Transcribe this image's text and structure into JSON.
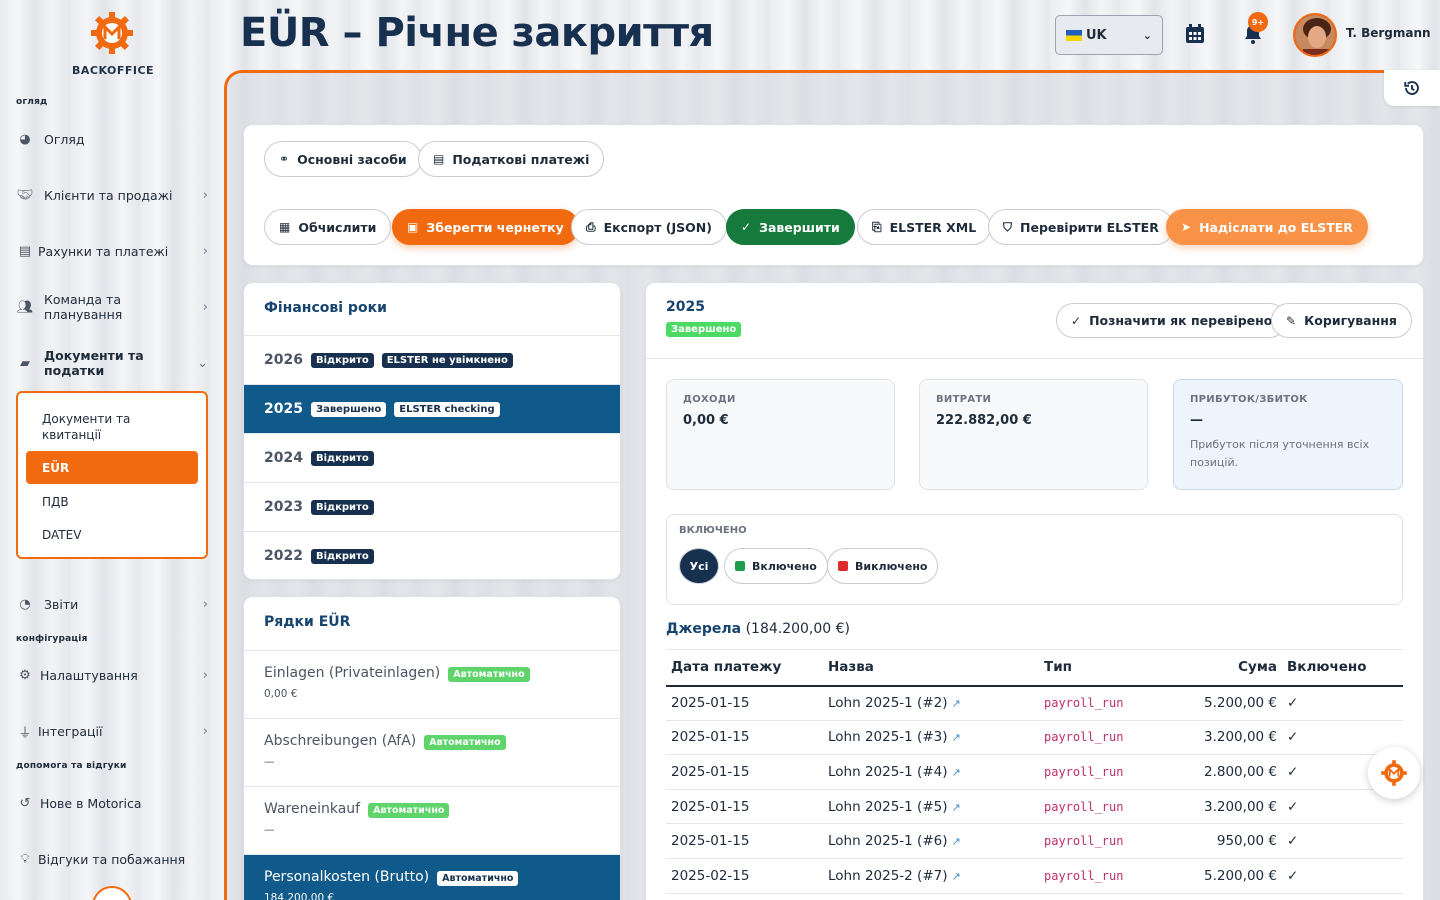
{
  "header": {
    "title": "EÜR – Річне закриття",
    "lang": "UK",
    "user": "T. Bergmann",
    "notif_badge": "9+"
  },
  "logo": {
    "brand": "BACKOFFICE"
  },
  "sidebar": {
    "sections": [
      "огляд",
      "конфігурація",
      "допомога та відгуки"
    ],
    "items": [
      {
        "label": "Огляд",
        "icon": "dashboard-icon"
      },
      {
        "label": "Клієнти та продажі",
        "icon": "handshake-icon"
      },
      {
        "label": "Рахунки та платежі",
        "icon": "invoice-icon"
      },
      {
        "label": "Команда та планування",
        "icon": "users-icon"
      },
      {
        "label": "Документи та податки",
        "icon": "folder-open-icon"
      },
      {
        "label": "Звіти",
        "icon": "pie-chart-icon"
      },
      {
        "label": "Налаштування",
        "icon": "gear-icon"
      },
      {
        "label": "Інтеграції",
        "icon": "plug-icon"
      },
      {
        "label": "Нове в Motorica",
        "icon": "history-icon"
      },
      {
        "label": "Відгуки та побажання",
        "icon": "lightbulb-icon"
      }
    ],
    "sub": [
      "Документи та квитанції",
      "EÜR",
      "ПДВ",
      "DATEV"
    ]
  },
  "toolbar": {
    "row1": [
      "Основні засоби",
      "Податкові платежі"
    ],
    "calc": "Обчислити",
    "save": "Зберегти чернетку",
    "export": "Експорт (JSON)",
    "finish": "Завершити",
    "xml": "ELSTER XML",
    "check": "Перевірити ELSTER",
    "send": "Надіслати до ELSTER"
  },
  "years": {
    "title": "Фінансові роки",
    "rows": [
      {
        "year": "2026",
        "status": "Відкрито",
        "extra": "ELSTER не увімкнено"
      },
      {
        "year": "2025",
        "status": "Завершено",
        "extra": "ELSTER checking"
      },
      {
        "year": "2024",
        "status": "Відкрито",
        "extra": ""
      },
      {
        "year": "2023",
        "status": "Відкрито",
        "extra": ""
      },
      {
        "year": "2022",
        "status": "Відкрито",
        "extra": ""
      }
    ]
  },
  "lines": {
    "title": "Рядки EÜR",
    "auto": "Автоматично",
    "rows": [
      {
        "name": "Einlagen (Privateinlagen)",
        "value": "0,00 €"
      },
      {
        "name": "Abschreibungen (AfA)",
        "value": "—"
      },
      {
        "name": "Wareneinkauf",
        "value": "—"
      },
      {
        "name": "Personalkosten (Brutto)",
        "value": "184.200,00 €"
      }
    ]
  },
  "detail": {
    "year": "2025",
    "status": "Завершено",
    "mark": "Позначити як перевірено",
    "adjust": "Коригування",
    "income_label": "ДОХОДИ",
    "income": "0,00 €",
    "expense_label": "ВИТРАТИ",
    "expense": "222.882,00 €",
    "profit_label": "ПРИБУТОК/ЗБИТОК",
    "profit": "—",
    "profit_hint": "Прибуток після уточнення всіх позицій.",
    "filter_label": "ВКЛЮЧЕНО",
    "f_all": "Усі",
    "f_in": "Включено",
    "f_out": "Виключено",
    "sources_label": "Джерела",
    "sources_sum": "(184.200,00 €)"
  },
  "table": {
    "headers": [
      "Дата платежу",
      "Назва",
      "Тип",
      "Сума",
      "Включено"
    ],
    "rows": [
      [
        "2025-01-15",
        "Lohn 2025-1 (#2)",
        "payroll_run",
        "5.200,00 €",
        "✓"
      ],
      [
        "2025-01-15",
        "Lohn 2025-1 (#3)",
        "payroll_run",
        "3.200,00 €",
        "✓"
      ],
      [
        "2025-01-15",
        "Lohn 2025-1 (#4)",
        "payroll_run",
        "2.800,00 €",
        "✓"
      ],
      [
        "2025-01-15",
        "Lohn 2025-1 (#5)",
        "payroll_run",
        "3.200,00 €",
        "✓"
      ],
      [
        "2025-01-15",
        "Lohn 2025-1 (#6)",
        "payroll_run",
        "950,00 €",
        "✓"
      ],
      [
        "2025-02-15",
        "Lohn 2025-2 (#7)",
        "payroll_run",
        "5.200,00 €",
        "✓"
      ]
    ]
  },
  "colors": {
    "accent": "#f26a10",
    "navy": "#17304f",
    "selected": "#0f5a8a",
    "success": "#157a3c"
  }
}
